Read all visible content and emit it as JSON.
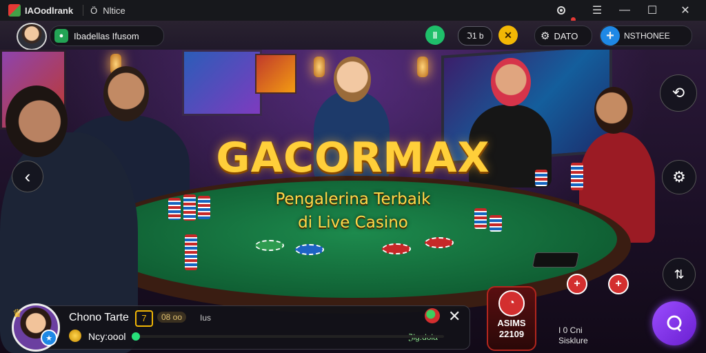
{
  "titlebar": {
    "app_name": "IAOodlrank",
    "tab_icon": "Ö",
    "tab_title": "Nltice"
  },
  "toolbar": {
    "room_label": "Ibadellas Ifusom",
    "stat_value": "ℑ1 b",
    "data_label": "DATO",
    "add_label": "NSTHONEE"
  },
  "headline": {
    "title": "GACORMAX",
    "sub_line1": "Pengalerina Terbaik",
    "sub_line2": "di Live Casino"
  },
  "bottom": {
    "player_name": "Chono Tarte",
    "badge_value": "7",
    "level_text": "08 oo",
    "tag_text": "Ius",
    "coin_label": "Ncy:oool",
    "balance_text": "ℨlg:dola",
    "progress": 0.0
  },
  "timer": {
    "line1": "ASIMS",
    "line2": "22109"
  },
  "side_note": {
    "line1": "I 0 Cni",
    "line2": "Sisklure"
  },
  "colors": {
    "accent_gold": "#ffcf3a",
    "felt_green": "#0f5d32",
    "brand_purple": "#7b3cf0",
    "alert_red": "#d32f2f"
  }
}
